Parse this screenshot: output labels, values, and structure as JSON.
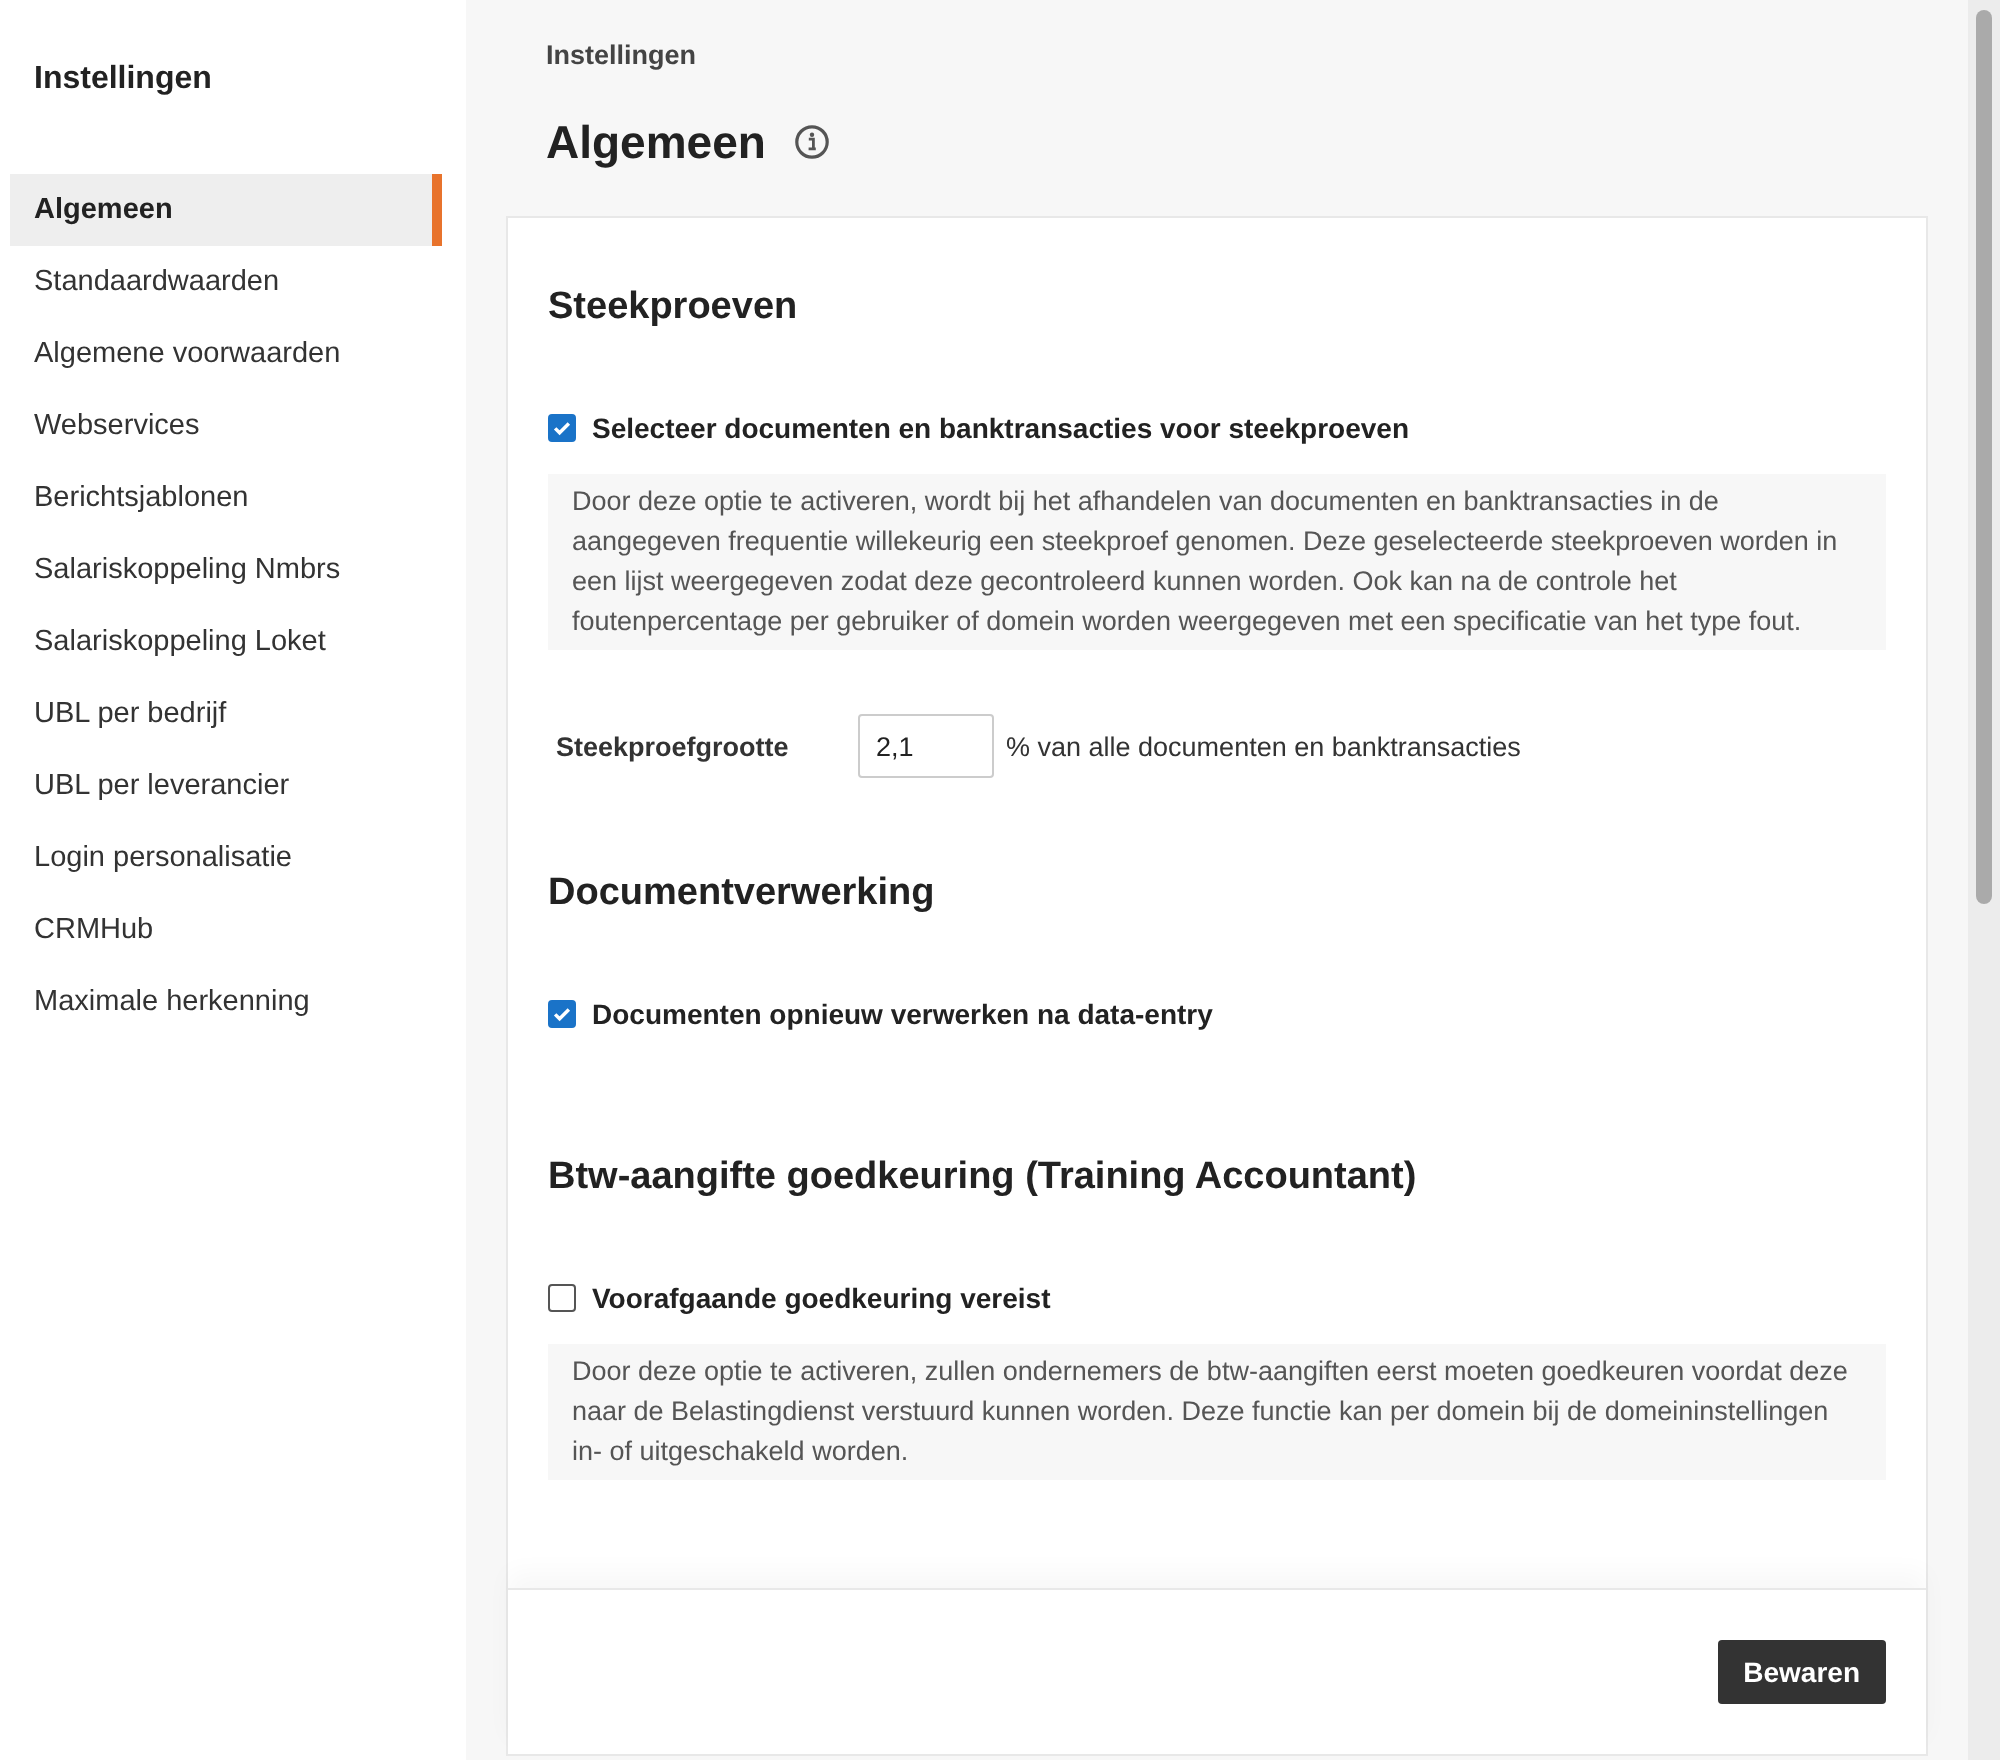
{
  "sidebar": {
    "title": "Instellingen",
    "items": [
      {
        "label": "Algemeen",
        "selected": true
      },
      {
        "label": "Standaardwaarden",
        "selected": false
      },
      {
        "label": "Algemene voorwaarden",
        "selected": false
      },
      {
        "label": "Webservices",
        "selected": false
      },
      {
        "label": "Berichtsjablonen",
        "selected": false
      },
      {
        "label": "Salariskoppeling Nmbrs",
        "selected": false
      },
      {
        "label": "Salariskoppeling Loket",
        "selected": false
      },
      {
        "label": "UBL per bedrijf",
        "selected": false
      },
      {
        "label": "UBL per leverancier",
        "selected": false
      },
      {
        "label": "Login personalisatie",
        "selected": false
      },
      {
        "label": "CRMHub",
        "selected": false
      },
      {
        "label": "Maximale herkenning",
        "selected": false
      }
    ]
  },
  "breadcrumb": "Instellingen",
  "page_title": "Algemeen",
  "sections": [
    {
      "title": "Steekproeven",
      "items": [
        {
          "kind": "checkbox",
          "label": "Selecteer documenten en banktransacties voor steekproeven",
          "checked": true,
          "description": "Door deze optie te activeren, wordt bij het afhandelen van documenten en banktransacties in de aangegeven frequentie willekeurig een steekproef genomen. Deze geselecteerde steekproeven worden in een lijst weergegeven zodat deze gecontroleerd kunnen worden. Ook kan na de controle het foutenpercentage per gebruiker of domein worden weergegeven met een specificatie van het type fout."
        },
        {
          "kind": "number",
          "label": "Steekproefgrootte",
          "value": "2,1",
          "suffix": "% van alle documenten en banktransacties"
        }
      ]
    },
    {
      "title": "Documentverwerking",
      "items": [
        {
          "kind": "checkbox",
          "label": "Documenten opnieuw verwerken na data-entry",
          "checked": true
        }
      ]
    },
    {
      "title": "Btw-aangifte goedkeuring (Training Accountant)",
      "items": [
        {
          "kind": "checkbox",
          "label": "Voorafgaande goedkeuring vereist",
          "checked": false,
          "description": "Door deze optie te activeren, zullen ondernemers de btw-aangiften eerst moeten goedkeuren voordat deze naar de Belastingdienst verstuurd kunnen worden. Deze functie kan per domein bij de domeininstellingen in- of uitgeschakeld worden."
        }
      ]
    }
  ],
  "save_button": "Bewaren"
}
